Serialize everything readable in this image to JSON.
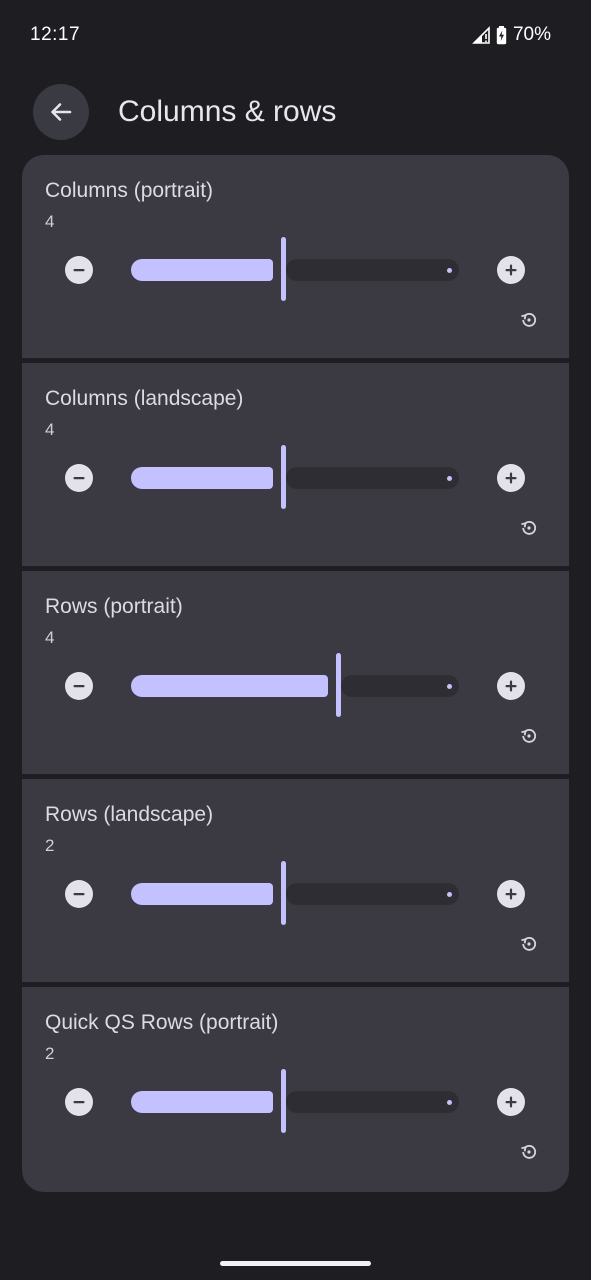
{
  "status_bar": {
    "time": "12:17",
    "battery": "70%",
    "icons": [
      "signal-icon",
      "battery-charging-icon"
    ]
  },
  "app_bar": {
    "title": "Columns & rows",
    "back_icon": "arrow-back-icon"
  },
  "colors": {
    "background": "#1d1d22",
    "card": "#3b3a42",
    "accent": "#c3c1ff",
    "track": "#2e2d34"
  },
  "settings": [
    {
      "title": "Columns (portrait)",
      "value": "4",
      "level": 0.5
    },
    {
      "title": "Columns (landscape)",
      "value": "4",
      "level": 0.5
    },
    {
      "title": "Rows (portrait)",
      "value": "4",
      "level": 0.667
    },
    {
      "title": "Rows (landscape)",
      "value": "2",
      "level": 0.5
    },
    {
      "title": "Quick QS Rows (portrait)",
      "value": "2",
      "level": 0.5
    }
  ]
}
